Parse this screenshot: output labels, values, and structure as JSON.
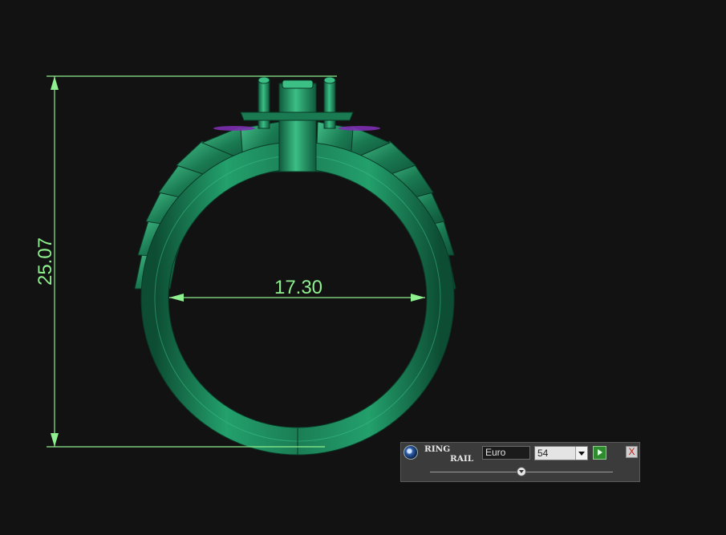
{
  "viewport": {
    "background": "#121212",
    "model": {
      "name": "ring-model",
      "color": "#1f8a5f",
      "gem_color": "#7d2fb0"
    },
    "dimensions": {
      "color": "#8ff08f",
      "height_value": "25.07",
      "inner_diameter_value": "17.30"
    }
  },
  "ring_rail_panel": {
    "title_line1": "RING",
    "title_line2": "RAIL",
    "unit_value": "Euro",
    "size_value": "54",
    "close_glyph": "X",
    "slider_level": 0.5
  }
}
